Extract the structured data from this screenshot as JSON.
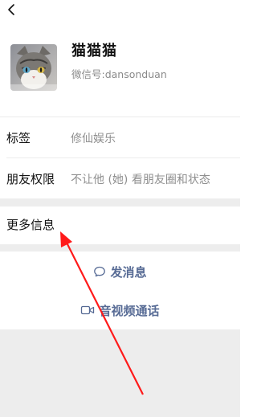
{
  "header": {
    "back_icon": "back-chevron-icon"
  },
  "profile": {
    "name": "猫猫猫",
    "wechat_id": "微信号:dansonduan",
    "avatar": "cat-photo-avatar"
  },
  "rows": [
    {
      "label": "标签",
      "value": "修仙娱乐"
    },
    {
      "label": "朋友权限",
      "value": "不让他 (她) 看朋友圈和状态"
    },
    {
      "label": "更多信息",
      "value": ""
    }
  ],
  "actions": {
    "message": {
      "label": "发消息",
      "icon": "chat-bubble-icon"
    },
    "call": {
      "label": "音视频通话",
      "icon": "video-camera-icon"
    }
  },
  "colors": {
    "link": "#576b95",
    "annotation_arrow": "#ff1a1a",
    "gap": "#ededed"
  }
}
